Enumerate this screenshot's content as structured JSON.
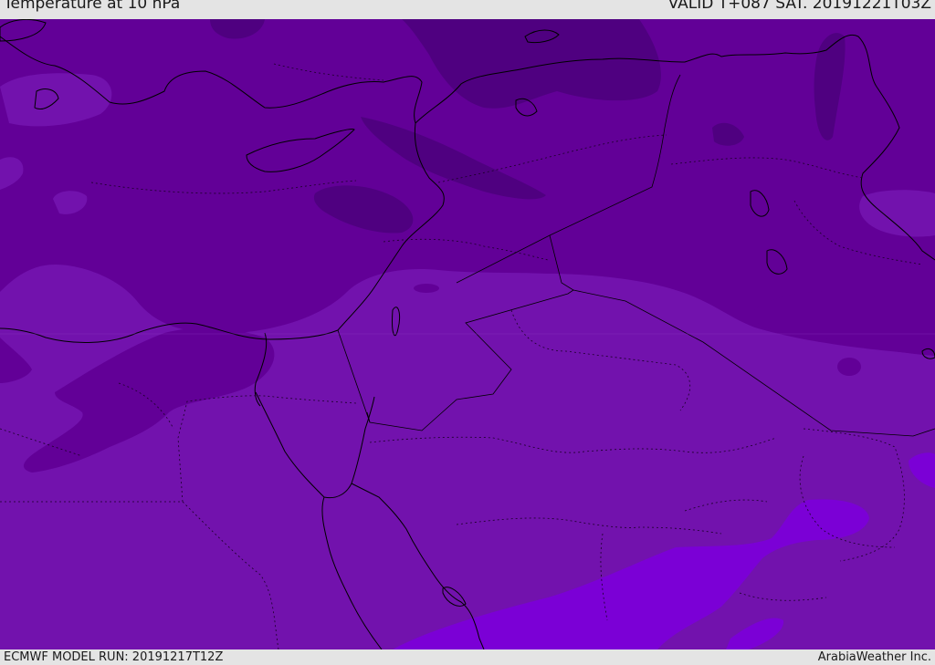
{
  "header": {
    "title": "Temperature at 10 hPa",
    "valid": "VALID T+087 SAT. 20191221T03Z"
  },
  "footer": {
    "model_run": "ECMWF MODEL RUN: 20191217T12Z",
    "credit": "ArabiaWeather Inc."
  },
  "map": {
    "colors": {
      "band_darkest": "#4f0080",
      "band_dark": "#620097",
      "band_mid": "#7212ad",
      "band_light": "#7715b8",
      "band_bright": "#7b00d6",
      "coastline": "#000000",
      "border": "#000000"
    }
  }
}
